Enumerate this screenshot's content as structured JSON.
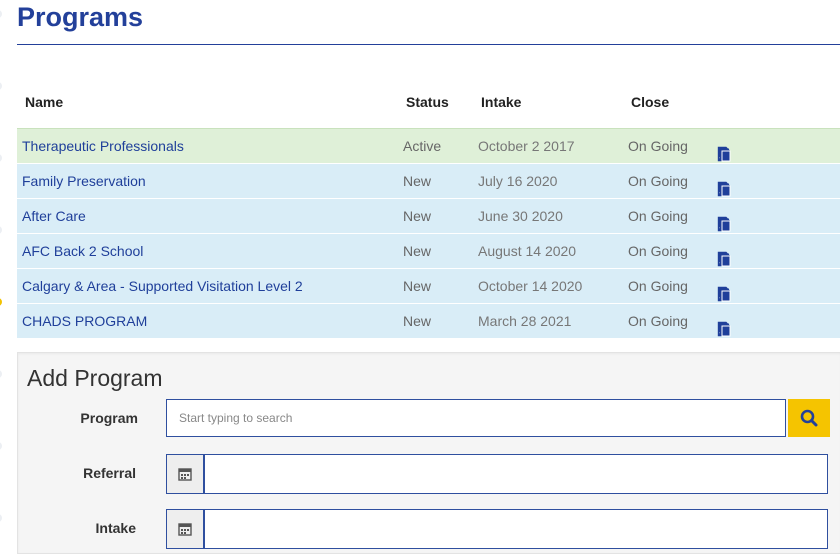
{
  "page": {
    "title": "Programs"
  },
  "table": {
    "headers": {
      "name": "Name",
      "status": "Status",
      "intake": "Intake",
      "close": "Close"
    },
    "rows": [
      {
        "name": "Therapeutic Professionals",
        "status": "Active",
        "intake": "October 2 2017",
        "close": "On Going"
      },
      {
        "name": "Family Preservation",
        "status": "New",
        "intake": "July 16 2020",
        "close": "On Going"
      },
      {
        "name": "After Care",
        "status": "New",
        "intake": "June 30 2020",
        "close": "On Going"
      },
      {
        "name": "AFC Back 2 School",
        "status": "New",
        "intake": "August 14 2020",
        "close": "On Going"
      },
      {
        "name": "Calgary & Area - Supported Visitation Level 2",
        "status": "New",
        "intake": "October 14 2020",
        "close": "On Going"
      },
      {
        "name": "CHADS PROGRAM",
        "status": "New",
        "intake": "March 28 2021",
        "close": "On Going"
      }
    ],
    "row_actions": [
      "pencil-icon",
      "pdf-icon",
      "user-icon",
      "trash-icon",
      "copy-icon"
    ]
  },
  "add_program": {
    "title": "Add Program",
    "program_label": "Program",
    "program_placeholder": "Start typing to search",
    "referral_label": "Referral",
    "intake_label": "Intake",
    "referral_value": "",
    "intake_value": ""
  },
  "colors": {
    "brand_blue": "#23409a",
    "accent_yellow": "#f5c400",
    "row_active": "#dff0d8",
    "row_new": "#d9edf7"
  }
}
